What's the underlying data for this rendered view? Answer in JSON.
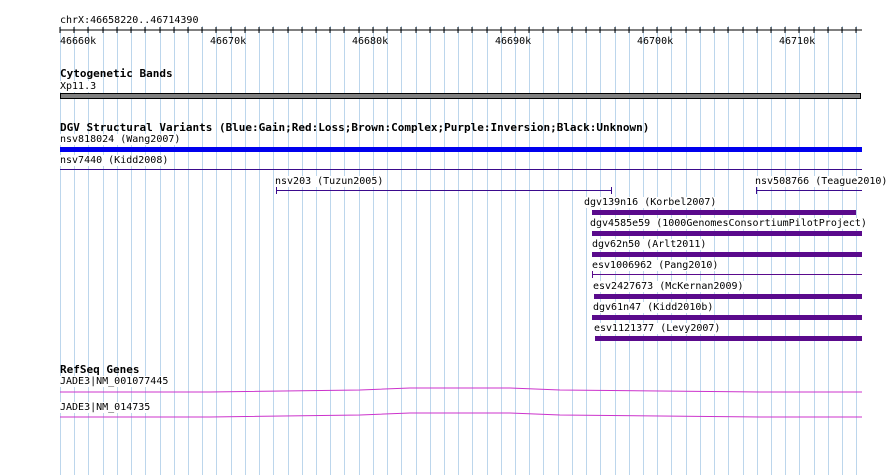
{
  "ruler": {
    "range_label": "chrX:46658220..46714390",
    "ticks": [
      "46660k",
      "46670k",
      "46680k",
      "46690k",
      "46700k",
      "46710k"
    ],
    "tick_positions_kb": [
      46660,
      46670,
      46680,
      46690,
      46700,
      46710
    ]
  },
  "tracks": {
    "cytogenetic": {
      "title": "Cytogenetic Bands",
      "band_label": "Xp11.3"
    },
    "dgv": {
      "title": "DGV Structural Variants (Blue:Gain;Red:Loss;Brown:Complex;Purple:Inversion;Black:Unknown)",
      "features": [
        {
          "label": "nsv818024 (Wang2007)",
          "color": "#0000ee"
        },
        {
          "label": "nsv7440 (Kidd2008)",
          "color": "#3a0a8c"
        },
        {
          "label": "nsv203 (Tuzun2005)",
          "color": "#3a0a8c"
        },
        {
          "label": "nsv508766 (Teague2010)",
          "color": "#3a0a8c"
        },
        {
          "label": "dgv139n16 (Korbel2007)",
          "color": "#5a0a8c"
        },
        {
          "label": "dgv4585e59 (1000GenomesConsortiumPilotProject)",
          "color": "#5a0a8c"
        },
        {
          "label": "dgv62n50 (Arlt2011)",
          "color": "#5a0a8c"
        },
        {
          "label": "esv1006962 (Pang2010)",
          "color": "#5a0a8c"
        },
        {
          "label": "esv2427673 (McKernan2009)",
          "color": "#5a0a8c"
        },
        {
          "label": "dgv61n47 (Kidd2010b)",
          "color": "#5a0a8c"
        },
        {
          "label": "esv1121377 (Levy2007)",
          "color": "#5a0a8c"
        }
      ]
    },
    "refseq": {
      "title": "RefSeq Genes",
      "genes": [
        {
          "label": "JADE3|NM_001077445",
          "color": "#cc33cc"
        },
        {
          "label": "JADE3|NM_014735",
          "color": "#cc33cc"
        }
      ]
    }
  }
}
